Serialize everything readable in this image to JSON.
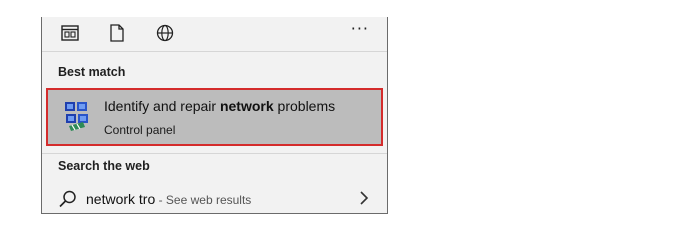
{
  "toolbar": {
    "icons": [
      "app-icon",
      "document-icon",
      "globe-icon"
    ],
    "more_label": "···"
  },
  "best_match": {
    "section_label": "Best match",
    "title_pre": "Identify and repair ",
    "title_bold": "network",
    "title_post": " problems",
    "subtitle": "Control panel",
    "icon": "network-troubleshooter-icon"
  },
  "web": {
    "section_label": "Search the web",
    "query": "network tro",
    "suffix": " - See web results",
    "icon": "search-icon"
  },
  "colors": {
    "highlight_border": "#d42b2b",
    "selected_bg": "#bcbcbc",
    "panel_bg": "#f2f2f2"
  }
}
